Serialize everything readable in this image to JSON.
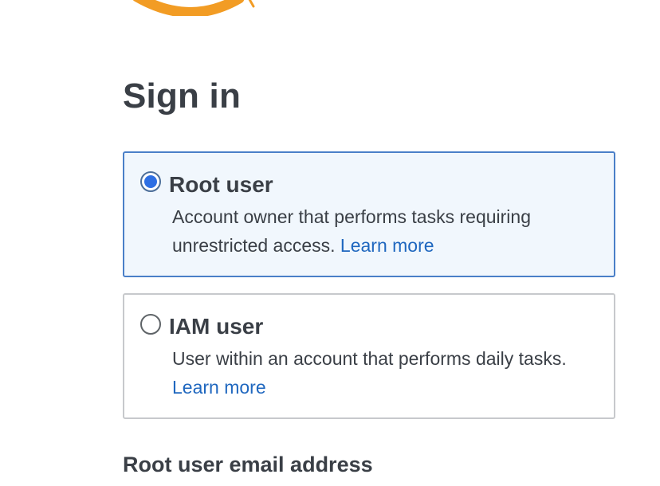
{
  "logo": {
    "name": "aws-smile-logo",
    "color": "#f29c24"
  },
  "page": {
    "title": "Sign in"
  },
  "options": [
    {
      "title": "Root user",
      "description": "Account owner that performs tasks requiring unrestricted access.",
      "link": "Learn more",
      "selected": true
    },
    {
      "title": "IAM user",
      "description": "User within an account that performs daily tasks.",
      "link": "Learn more",
      "selected": false
    }
  ],
  "form": {
    "email_label": "Root user email address"
  },
  "colors": {
    "selected_border": "#4a7fc8",
    "selected_background": "#f1f7fd",
    "radio_fill": "#2e6fe3",
    "link": "#1f67bf",
    "unselected_border": "#c7c9cc"
  }
}
